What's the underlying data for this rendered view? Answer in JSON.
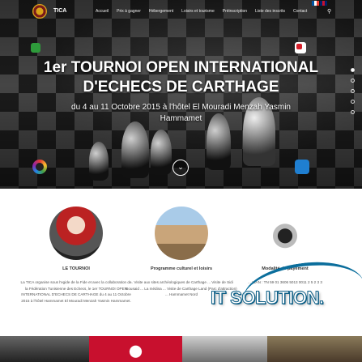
{
  "header": {
    "brand": "TICA",
    "menu": [
      "Accueil",
      "Prix à gagner",
      "Hébergement",
      "Loisirs et tourisme",
      "Préinscription",
      "Liste des inscrits",
      "Contact"
    ],
    "search_icon": "search-icon",
    "languages": [
      "fr",
      "en"
    ]
  },
  "hero": {
    "title_line1": "1er TOURNOI OPEN INTERNATIONAL",
    "title_line2": "D'ECHECS DE CARTHAGE",
    "subtitle": "du 4 au 11 Octobre 2015 à l'hôtel El Mouradi Menzah Yasmin Hammamet",
    "scroll_icon": "chevron-down-icon",
    "slide_count": 5,
    "active_slide": 1
  },
  "features": [
    {
      "title": "LE TOURNOI",
      "text": "La TICA organise sous l'egide de la Fide et avec la collaboration de la Fédération Tunisienne des Echecs, le 1er TOURNOI OPEN INTERNATIONAL D'ECHECS DE CARTHAGE du 4 au 11 Octobre 2015 à l'hôtel Hammamet El Mouradi Menzah Yasmin Hammamet."
    },
    {
      "title": "Programme culturel et loisirs",
      "text": "... Visite aux sites archéologiques de Carthage ... Visite de Sidi Bousaid ... La médina ... Visite de Carthage Land (Parc d'attraction) ... Hammamet Nord"
    },
    {
      "title": "Modalité de payement",
      "text": "... IBAN : TN 59 01 3606 5013 0011 2 5 2 3 3"
    }
  ],
  "watermark": {
    "text": "IT SOLUTION."
  },
  "colors": {
    "watermark_stroke": "#0b5e86",
    "brand_gold": "#d9a31a"
  }
}
